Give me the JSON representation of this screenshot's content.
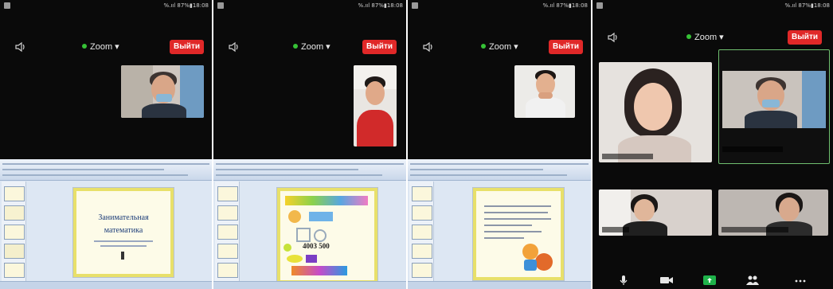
{
  "phone1": {
    "status_right": "%.ııl 87%▮18:08",
    "meeting_title": "Zoom",
    "leave_label": "Выйти",
    "slide_title_line1": "Занимательная",
    "slide_title_line2": "математика"
  },
  "phone2": {
    "status_right": "%.ııl 87%▮18:08",
    "meeting_title": "Zoom",
    "leave_label": "Выйти",
    "slide_number_text": "4003 500"
  },
  "phone3": {
    "status_right": "%.ııl 87%▮18:08",
    "meeting_title": "Zoom",
    "leave_label": "Выйти"
  },
  "phone4": {
    "status_right": "%.ııl 87%▮18:08",
    "meeting_title": "Zoom",
    "leave_label": "Выйти"
  },
  "colors": {
    "leave_button": "#e02828",
    "secure_dot": "#36c236",
    "active_speaker_border": "#6fbf6f",
    "toolbar_green": "#1fb24a"
  }
}
